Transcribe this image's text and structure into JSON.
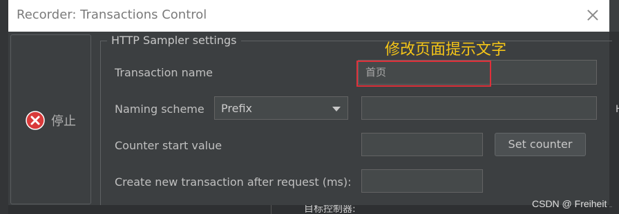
{
  "window": {
    "title": "Recorder: Transactions Control"
  },
  "stop_button": {
    "label": "停止"
  },
  "group": {
    "title": "HTTP Sampler settings"
  },
  "transaction_name": {
    "label": "Transaction name",
    "value": "首页"
  },
  "naming_scheme": {
    "label": "Naming scheme",
    "selected": "Prefix"
  },
  "counter_start": {
    "label": "Counter start value",
    "value": ""
  },
  "set_counter": {
    "label": "Set counter"
  },
  "create_new": {
    "label": "Create new transaction after request (ms):",
    "value": ""
  },
  "annotation": {
    "text": "修改页面提示文字"
  },
  "watermark": {
    "text": "CSDN @ Freiheit"
  },
  "background": {
    "right_edge_char": "H",
    "bottom_text": "目标控制器:"
  },
  "colors": {
    "bg": "#3c3f41",
    "highlight": "#e0303a",
    "annotation": "#f5c518"
  }
}
